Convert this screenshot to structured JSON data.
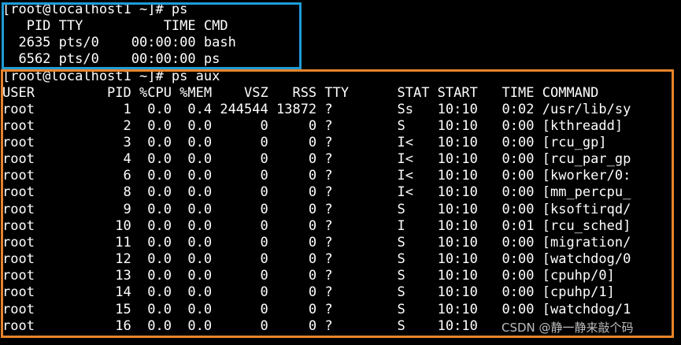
{
  "colors": {
    "background": "#000000",
    "text": "#ffffff",
    "ps_highlight_border": "#1f9bd6",
    "psaux_highlight_border": "#e7842a",
    "watermark": "#bdbdbd"
  },
  "terminal": {
    "lines": [
      "[root@localhost1 ~]# ps",
      "   PID TTY          TIME CMD",
      "  2635 pts/0    00:00:00 bash",
      "  6562 pts/0    00:00:00 ps",
      "[root@localhost1 ~]# ps aux",
      "USER         PID %CPU %MEM    VSZ   RSS TTY      STAT START   TIME COMMAND",
      "root           1  0.0  0.4 244544 13872 ?        Ss   10:10   0:02 /usr/lib/sy",
      "root           2  0.0  0.0      0     0 ?        S    10:10   0:00 [kthreadd]",
      "root           3  0.0  0.0      0     0 ?        I<   10:10   0:00 [rcu_gp]",
      "root           4  0.0  0.0      0     0 ?        I<   10:10   0:00 [rcu_par_gp",
      "root           6  0.0  0.0      0     0 ?        I<   10:10   0:00 [kworker/0:",
      "root           8  0.0  0.0      0     0 ?        I<   10:10   0:00 [mm_percpu_",
      "root           9  0.0  0.0      0     0 ?        S    10:10   0:00 [ksoftirqd/",
      "root          10  0.0  0.0      0     0 ?        I    10:10   0:01 [rcu_sched]",
      "root          11  0.0  0.0      0     0 ?        S    10:10   0:00 [migration/",
      "root          12  0.0  0.0      0     0 ?        S    10:10   0:00 [watchdog/0",
      "root          13  0.0  0.0      0     0 ?        S    10:10   0:00 [cpuhp/0]",
      "root          14  0.0  0.0      0     0 ?        S    10:10   0:00 [cpuhp/1]",
      "root          15  0.0  0.0      0     0 ?        S    10:10   0:00 [watchdog/1",
      "root          16  0.0  0.0      0     0 ?        S    10:10"
    ]
  },
  "watermark": "CSDN @静一静来敲个码"
}
